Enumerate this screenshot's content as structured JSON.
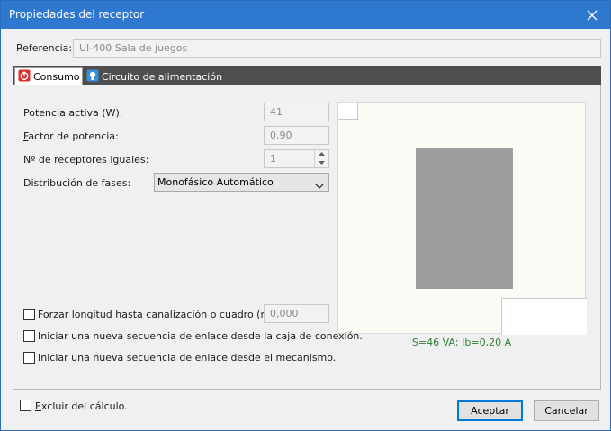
{
  "window": {
    "title": "Propiedades del receptor"
  },
  "referencia": {
    "label": "Referencia:",
    "value": "UI-400 Sala de juegos"
  },
  "tabs": [
    {
      "label": "Consumo",
      "icon": "power-icon",
      "active": true
    },
    {
      "label": "Circuito de alimentación",
      "icon": "lightbulb-icon",
      "active": false
    }
  ],
  "consumo": {
    "potencia": {
      "label": "Potencia activa (W):",
      "value": "41"
    },
    "factor": {
      "label_prefix": "F",
      "label_rest": "actor de potencia:",
      "value": "0,90"
    },
    "receptores": {
      "label": "Nº de receptores iguales:",
      "value": "1"
    },
    "distribucion": {
      "label": "Distribución de fases:",
      "value": "Monofásico Automático"
    },
    "forzar": {
      "label": "Forzar longitud hasta canalización o cuadro (m):",
      "value": "0,000",
      "checked": false
    },
    "secuencia_caja": {
      "label": "Iniciar una nueva secuencia de enlace desde la caja de conexión.",
      "checked": false
    },
    "secuencia_mecanismo": {
      "label": "Iniciar una nueva secuencia de enlace desde el mecanismo.",
      "checked": false
    }
  },
  "preview": {
    "summary": "S=46 VA; Ib=0,20 A"
  },
  "footer": {
    "excluir": {
      "label_prefix": "E",
      "label_rest": "xcluir del cálculo.",
      "checked": false
    },
    "aceptar": "Aceptar",
    "cancelar": "Cancelar"
  },
  "colors": {
    "titlebar": "#2f78cf",
    "tabstrip": "#4e4e4e",
    "summary": "#2e7d32"
  }
}
